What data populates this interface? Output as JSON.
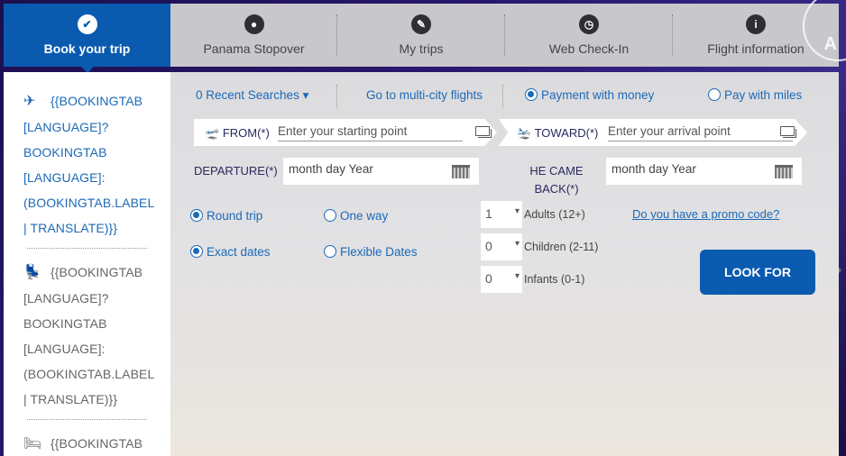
{
  "tabs": [
    {
      "label": "Book your trip",
      "icon": "check-circle-icon",
      "glyph": "✔",
      "active": true
    },
    {
      "label": "Panama Stopover",
      "icon": "map-pin-icon",
      "glyph": "●"
    },
    {
      "label": "My trips",
      "icon": "pencil-icon",
      "glyph": "✎"
    },
    {
      "label": "Web Check-In",
      "icon": "clock-icon",
      "glyph": "◷"
    },
    {
      "label": "Flight information",
      "icon": "info-icon",
      "glyph": "i"
    }
  ],
  "brand_letter": "A",
  "side": {
    "items": [
      {
        "glyph": "✈",
        "icon": "airplane-icon",
        "text": "{{BOOKINGTAB [LANGUAGE]? BOOKINGTAB [LANGUAGE]: (BOOKINGTAB.LABEL | TRANSLATE)}}",
        "lines": [
          "{{BOOKINGTAB",
          "[LANGUAGE]?",
          "BOOKINGTAB",
          "[LANGUAGE]:",
          "(BOOKINGTAB.LABEL",
          "| TRANSLATE)}}"
        ]
      },
      {
        "glyph": "💺",
        "icon": "seat-icon",
        "lines": [
          "{{BOOKINGTAB",
          "[LANGUAGE]?",
          "BOOKINGTAB",
          "[LANGUAGE]:",
          "(BOOKINGTAB.LABEL",
          "| TRANSLATE)}}"
        ]
      },
      {
        "glyph": "🛏",
        "icon": "bed-icon",
        "lines": [
          "{{BOOKINGTAB"
        ]
      }
    ]
  },
  "main": {
    "recent_searches": "0 Recent Searches ▾",
    "multi_city": "Go to multi-city flights",
    "payment_money": "Payment with money",
    "payment_miles": "Pay with miles",
    "from_label": "FROM(*)",
    "from_placeholder": "Enter your starting point",
    "toward_label": "TOWARD(*)",
    "toward_placeholder": "Enter your arrival point",
    "departure_label": "DEPARTURE(*)",
    "departure_placeholder": "month day Year",
    "return_label_1": "HE CAME",
    "return_label_2": "BACK(*)",
    "return_placeholder": "month day Year",
    "round_trip": "Round trip",
    "one_way": "One way",
    "exact_dates": "Exact dates",
    "flexible_dates": "Flexible Dates",
    "adults_value": "1",
    "adults_label": "Adults (12+)",
    "children_value": "0",
    "children_label": "Children (2-11)",
    "infants_value": "0",
    "infants_label": "Infants (0-1)",
    "promo": "Do you have a promo code?",
    "search_button": "LOOK FOR"
  }
}
